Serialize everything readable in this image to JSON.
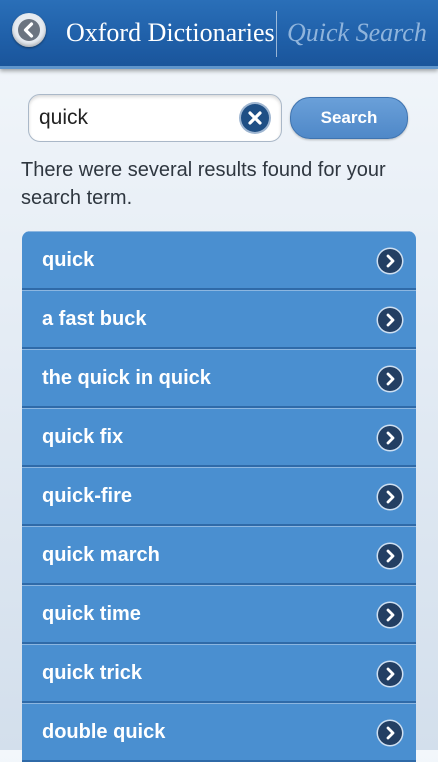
{
  "header": {
    "title": "Oxford Dictionaries",
    "subtitle": "Quick Search",
    "back_icon": "chevron-left-icon"
  },
  "search": {
    "value": "quick",
    "placeholder": "",
    "clear_icon": "clear-x-icon",
    "button_label": "Search"
  },
  "message": "There were several results found for your search term.",
  "results": [
    {
      "label": "quick"
    },
    {
      "label": "a fast buck"
    },
    {
      "label": "the quick in quick"
    },
    {
      "label": "quick fix"
    },
    {
      "label": "quick-fire"
    },
    {
      "label": "quick march"
    },
    {
      "label": "quick time"
    },
    {
      "label": "quick trick"
    },
    {
      "label": "double quick"
    }
  ],
  "colors": {
    "header": "#1f5fa8",
    "row": "#4a8fd0",
    "search_button": "#5a93d0"
  }
}
